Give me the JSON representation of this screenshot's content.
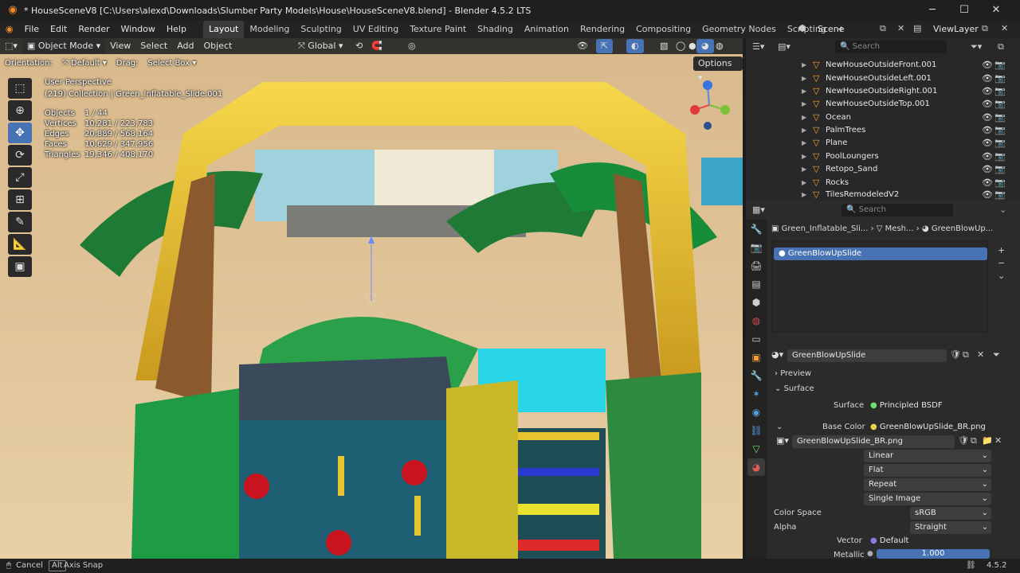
{
  "titlebar": {
    "title": "* HouseSceneV8 [C:\\Users\\alexd\\Downloads\\Slumber Party Models\\House\\HouseSceneV8.blend] - Blender 4.5.2 LTS",
    "minimize": "─",
    "maximize": "☐",
    "close": "✕"
  },
  "menubar": {
    "menus": [
      "File",
      "Edit",
      "Render",
      "Window",
      "Help"
    ],
    "workspaces": [
      "Layout",
      "Modeling",
      "Sculpting",
      "UV Editing",
      "Texture Paint",
      "Shading",
      "Animation",
      "Rendering",
      "Compositing",
      "Geometry Nodes",
      "Scripting"
    ],
    "active_workspace": "Layout",
    "add_tab": "+",
    "scene": "Scene",
    "view_layer": "ViewLayer"
  },
  "viewport_header": {
    "mode": "Object Mode",
    "menus": [
      "View",
      "Select",
      "Add",
      "Object"
    ],
    "transform": "Global"
  },
  "tool_settings": {
    "orientation_label": "Orientation:",
    "orientation_value": "Default",
    "drag_label": "Drag:",
    "drag_value": "Select Box",
    "options": "Options"
  },
  "overlay": {
    "perspective": "User Perspective",
    "collection": "(219) Collection | Green_Inflatable_Slide.001",
    "stats": [
      {
        "key": "Objects",
        "value": "1 / 44"
      },
      {
        "key": "Vertices",
        "value": "10,281 / 223,783"
      },
      {
        "key": "Edges",
        "value": "20,889 / 568,164"
      },
      {
        "key": "Faces",
        "value": "10,629 / 347,956"
      },
      {
        "key": "Triangles",
        "value": "19,346 / 408,170"
      }
    ]
  },
  "outliner": {
    "search_placeholder": "Search",
    "items": [
      "NewHouseOutsideFront.001",
      "NewHouseOutsideLeft.001",
      "NewHouseOutsideRight.001",
      "NewHouseOutsideTop.001",
      "Ocean",
      "PalmTrees",
      "Plane",
      "PoolLoungers",
      "Retopo_Sand",
      "Rocks",
      "TilesRemodeledV2"
    ]
  },
  "properties": {
    "search_placeholder": "Search",
    "breadcrumb": [
      "Green_Inflatable_Sli...",
      "Mesh...",
      "GreenBlowUp..."
    ],
    "material_slot": "GreenBlowUpSlide",
    "material_name": "GreenBlowUpSlide",
    "preview_label": "Preview",
    "surface_label": "Surface",
    "surface_field_label": "Surface",
    "surface_value": "Principled BSDF",
    "base_color_label": "Base Color",
    "base_color_value": "GreenBlowUpSlide_BR.png",
    "image_name": "GreenBlowUpSlide_BR.png",
    "interpolation": "Linear",
    "projection": "Flat",
    "extension": "Repeat",
    "source": "Single Image",
    "color_space_label": "Color Space",
    "color_space_value": "sRGB",
    "alpha_label": "Alpha",
    "alpha_value": "Straight",
    "vector_label": "Vector",
    "vector_value": "Default",
    "metallic_label": "Metallic",
    "metallic_value": "1.000"
  },
  "statusbar": {
    "cancel": "Cancel",
    "alt_key": "Alt",
    "axis_snap": "Axis Snap",
    "version": "4.5.2"
  },
  "colors": {
    "accent": "#4772b3",
    "object_icon": "#f2a033",
    "mesh_icon": "#6fe06f"
  }
}
